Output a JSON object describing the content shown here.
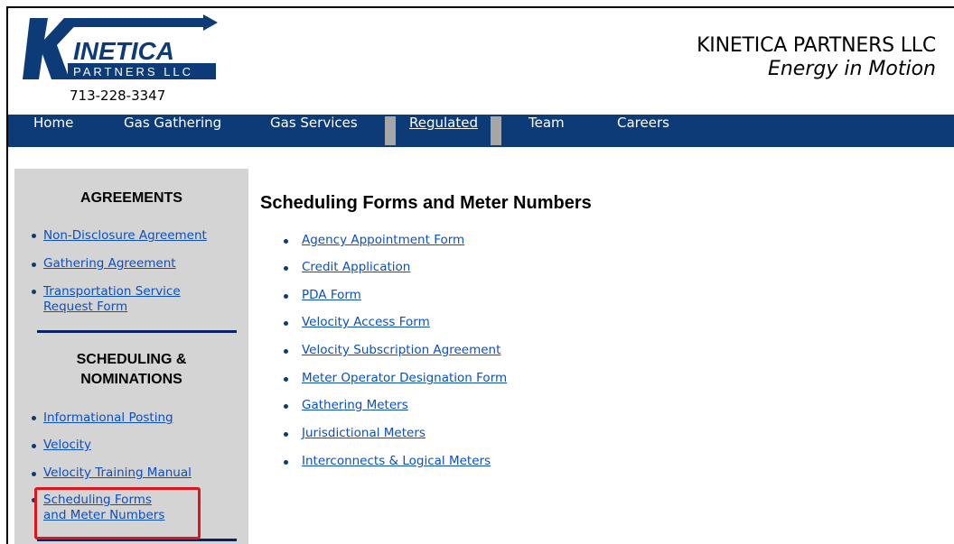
{
  "company": {
    "phone": "713-228-3347",
    "name": "KINETICA PARTNERS LLC",
    "tagline": "Energy in Motion",
    "logo_word": "INETICA",
    "logo_sub": "PARTNERS LLC"
  },
  "nav": {
    "items": [
      {
        "label": "Home"
      },
      {
        "label": "Gas Gathering"
      },
      {
        "label": "Gas Services"
      },
      {
        "label": "Regulated"
      },
      {
        "label": "Team"
      },
      {
        "label": "Careers"
      }
    ]
  },
  "sidebar": {
    "agreements": {
      "heading": "AGREEMENTS",
      "links": [
        "Non-Disclosure Agreement",
        "Gathering Agreement",
        "Transportation Service",
        "Request Form"
      ]
    },
    "scheduling": {
      "heading_line1": "SCHEDULING &",
      "heading_line2": "NOMINATIONS",
      "links": [
        "Informational Posting",
        "Velocity",
        "Velocity Training Manual",
        "Scheduling Forms",
        "and Meter Numbers"
      ]
    }
  },
  "main": {
    "title": "Scheduling Forms and Meter Numbers",
    "links": [
      "Agency Appointment Form",
      "Credit Application",
      "PDA Form",
      "Velocity Access Form",
      "Velocity Subscription Agreement",
      "Meter Operator Designation Form",
      "Gathering Meters",
      "Jurisdictional Meters",
      "Interconnects & Logical Meters"
    ]
  },
  "colors": {
    "nav_bg": "#0d3b78",
    "link": "#0b4fc3",
    "sidebar_bg": "#d4d4d4",
    "highlight": "#e0141b"
  }
}
